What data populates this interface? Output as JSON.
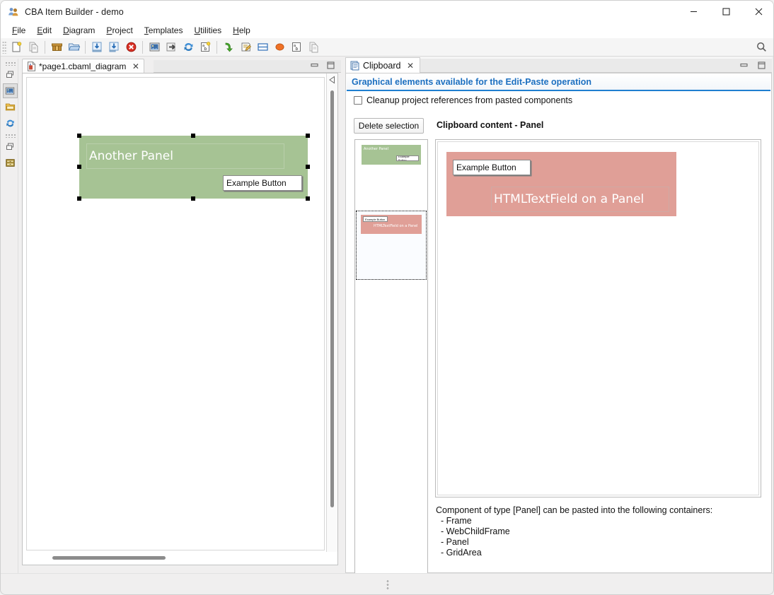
{
  "window": {
    "title": "CBA Item Builder - demo",
    "app_icon": "people-icon",
    "minimize": "–",
    "maximize": "□",
    "close": "✕"
  },
  "menubar": {
    "items": [
      {
        "name": "file",
        "label": "File",
        "mnemonic": "F"
      },
      {
        "name": "edit",
        "label": "Edit",
        "mnemonic": "E"
      },
      {
        "name": "diagram",
        "label": "Diagram",
        "mnemonic": "D"
      },
      {
        "name": "project",
        "label": "Project",
        "mnemonic": "P"
      },
      {
        "name": "templates",
        "label": "Templates",
        "mnemonic": "T"
      },
      {
        "name": "utilities",
        "label": "Utilities",
        "mnemonic": "U"
      },
      {
        "name": "help",
        "label": "Help",
        "mnemonic": "H"
      }
    ]
  },
  "toolbar": {
    "buttons": [
      {
        "name": "new-file-icon",
        "title": "New"
      },
      {
        "name": "copy-file-icon",
        "title": "Copy"
      },
      {
        "name": "archive-box-icon",
        "title": "Open project"
      },
      {
        "name": "open-folder-icon",
        "title": "Open"
      },
      {
        "name": "import-icon",
        "title": "Import"
      },
      {
        "name": "export-icon",
        "title": "Export"
      },
      {
        "name": "delete-error-icon",
        "title": "Delete"
      },
      {
        "name": "image-icon",
        "title": "Image"
      },
      {
        "name": "arrow-into-box-icon",
        "title": "Insert"
      },
      {
        "name": "refresh-icon",
        "title": "Refresh"
      },
      {
        "name": "rename-ab-icon",
        "title": "Rename"
      },
      {
        "name": "green-arrow-down-icon",
        "title": "Deploy"
      },
      {
        "name": "edit-note-icon",
        "title": "Edit"
      },
      {
        "name": "split-window-icon",
        "title": "Layout"
      },
      {
        "name": "orange-circle-icon",
        "title": "Run"
      },
      {
        "name": "ab-label-icon",
        "title": "Label"
      },
      {
        "name": "duplicate-icon",
        "title": "Duplicate"
      }
    ],
    "search": {
      "name": "search-icon",
      "title": "Search"
    }
  },
  "rail": {
    "items": [
      {
        "name": "restore-view-icon"
      },
      {
        "name": "image-view-icon",
        "selected": true
      },
      {
        "name": "folder-view-icon"
      },
      {
        "name": "refresh-view-icon"
      },
      {
        "name": "restore-view-icon-2"
      },
      {
        "name": "drawer-view-icon"
      }
    ]
  },
  "editor": {
    "tab": {
      "label": "*page1.cbaml_diagram",
      "icon": "diagram-file-icon",
      "close": "✕"
    },
    "window_buttons": {
      "minimize": "minimize-icon",
      "maximize": "maximize-icon"
    },
    "collapse_arrow": "collapse-left-icon",
    "canvas": {
      "panel": {
        "name": "Another Panel",
        "fill": "#a6c394",
        "label_text": "Another Panel",
        "button_label": "Example Button",
        "selected": true
      }
    }
  },
  "clipboard_view": {
    "tab": {
      "label": "Clipboard",
      "icon": "clipboard-icon",
      "close": "✕"
    },
    "window_buttons": {
      "minimize": "minimize-icon",
      "maximize": "maximize-icon"
    },
    "header": "Graphical elements available for the Edit-Paste operation",
    "header_color": "#1c6fc0",
    "cleanup_checkbox": {
      "label": "Cleanup project references from pasted components",
      "checked": false
    },
    "delete_selection_button": "Delete selection",
    "content_title": "Clipboard content - Panel",
    "thumbnails": [
      {
        "name": "thumbnail-another-panel",
        "selected": false,
        "fill": "#a6c394",
        "label": "Another Panel",
        "button_label": "Example Button"
      },
      {
        "name": "thumbnail-htmltextfield-panel",
        "selected": true,
        "fill": "#e09f97",
        "label": "HTMLTextField on a Panel",
        "button_label": "Example Button"
      }
    ],
    "preview": {
      "fill": "#e09f97",
      "button_label": "Example Button",
      "text_field_label": "HTMLTextField on a Panel"
    },
    "paste_info": {
      "lead": "Component of type [Panel] can be pasted into the following containers:",
      "containers": [
        "- Frame",
        "- WebChildFrame",
        "- Panel",
        "- GridArea"
      ]
    }
  },
  "statusbar": {
    "grip": "resize-grip-icon"
  }
}
